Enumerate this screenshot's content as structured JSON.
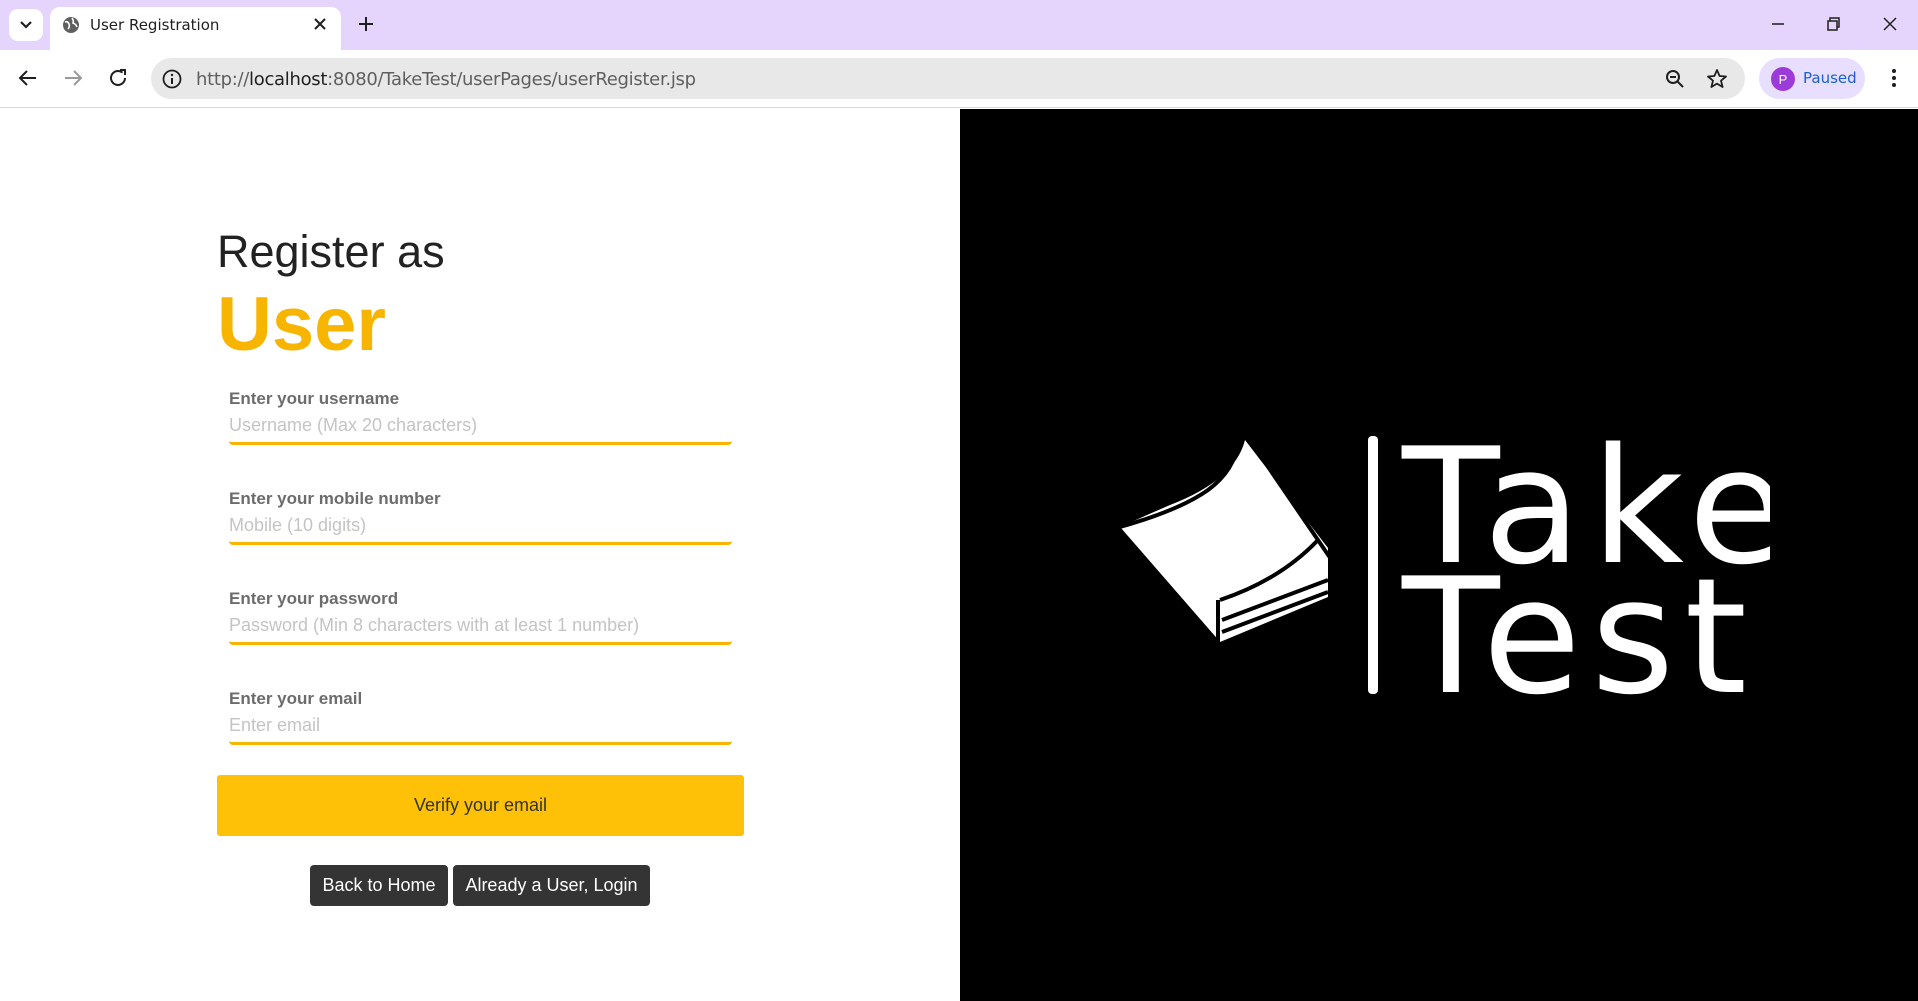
{
  "browser": {
    "tab_title": "User Registration",
    "url_scheme": "http://",
    "url_host": "localhost",
    "url_rest": ":8080/TakeTest/userPages/userRegister.jsp",
    "profile_initial": "P",
    "profile_status": "Paused"
  },
  "page": {
    "heading_sub": "Register as",
    "heading_main": "User",
    "fields": [
      {
        "label": "Enter your username",
        "placeholder": "Username (Max 20 characters)",
        "value": ""
      },
      {
        "label": "Enter your mobile number",
        "placeholder": "Mobile (10 digits)",
        "value": ""
      },
      {
        "label": "Enter your password",
        "placeholder": "Password (Min 8 characters with at least 1 number)",
        "value": ""
      },
      {
        "label": "Enter your email",
        "placeholder": "Enter email",
        "value": ""
      }
    ],
    "verify_button": "Verify your email",
    "back_home_button": "Back to Home",
    "login_button": "Already a User, Login"
  },
  "logo": {
    "line1": "Take",
    "line2": "Test"
  },
  "colors": {
    "accent": "#f7b500",
    "button_yellow": "#fec107",
    "dark_button": "#343434",
    "tab_strip": "#e5d4fb"
  }
}
